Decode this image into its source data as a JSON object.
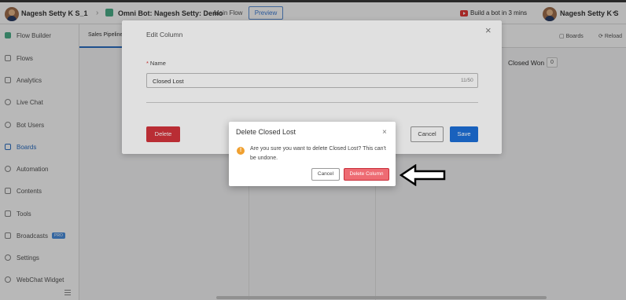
{
  "topbar": {
    "user_name": "Nagesh Setty K S_1",
    "bot_title": "Omni Bot: Nagesh Setty: Demo",
    "flow_name": "Main Flow",
    "preview_label": "Preview",
    "build_bot_label": "Build a bot in 3 mins",
    "account_name": "Nagesh Setty K S"
  },
  "sidebar": {
    "items": [
      {
        "label": "Flow Builder"
      },
      {
        "label": "Flows"
      },
      {
        "label": "Analytics"
      },
      {
        "label": "Live Chat"
      },
      {
        "label": "Bot Users"
      },
      {
        "label": "Boards"
      },
      {
        "label": "Automation"
      },
      {
        "label": "Contents"
      },
      {
        "label": "Tools"
      },
      {
        "label": "Broadcasts",
        "badge": "PRO"
      },
      {
        "label": "Settings"
      },
      {
        "label": "WebChat Widget"
      }
    ],
    "active_index": 5
  },
  "main": {
    "tab_label": "Sales Pipeline",
    "header_boards": "Boards",
    "header_reload": "Reload",
    "column_title": "Closed Won",
    "column_count": "0"
  },
  "edit_column": {
    "title": "Edit Column",
    "name_label": "Name",
    "name_value": "Closed Lost",
    "char_count": "11/50",
    "delete_label": "Delete",
    "cancel_label": "Cancel",
    "save_label": "Save"
  },
  "confirm_dialog": {
    "title": "Delete Closed Lost",
    "message": "Are you sure you want to delete Closed Lost? This can't be undone.",
    "cancel_label": "Cancel",
    "confirm_label": "Delete Column"
  },
  "colors": {
    "primary": "#1d6fd8",
    "danger": "#d3343c",
    "danger_light": "#ee6b73",
    "warning": "#f0a030"
  }
}
